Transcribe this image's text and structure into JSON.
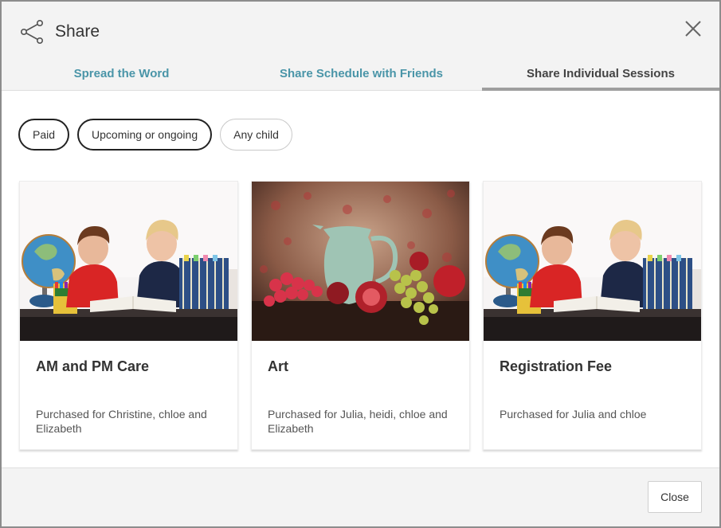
{
  "header": {
    "title": "Share",
    "share_icon": "share-icon",
    "close_icon": "close-icon"
  },
  "tabs": [
    {
      "label": "Spread the Word",
      "active": false
    },
    {
      "label": "Share Schedule with Friends",
      "active": false
    },
    {
      "label": "Share Individual Sessions",
      "active": true
    }
  ],
  "filters": [
    {
      "label": "Paid",
      "active": true
    },
    {
      "label": "Upcoming or ongoing",
      "active": true
    },
    {
      "label": "Any child",
      "active": false
    }
  ],
  "cards": [
    {
      "title": "AM and PM Care",
      "description": "Purchased for Christine, chloe and Elizabeth",
      "image": "children-reading-photo"
    },
    {
      "title": "Art",
      "description": "Purchased for Julia, heidi, chloe and Elizabeth",
      "image": "fruit-still-life-painting"
    },
    {
      "title": "Registration Fee",
      "description": "Purchased for Julia and chloe",
      "image": "children-reading-photo"
    }
  ],
  "footer": {
    "close_label": "Close"
  },
  "colors": {
    "tab_link": "#4a95a8",
    "active_tab_underline": "#9e9e9e",
    "header_bg": "#f3f3f3"
  }
}
